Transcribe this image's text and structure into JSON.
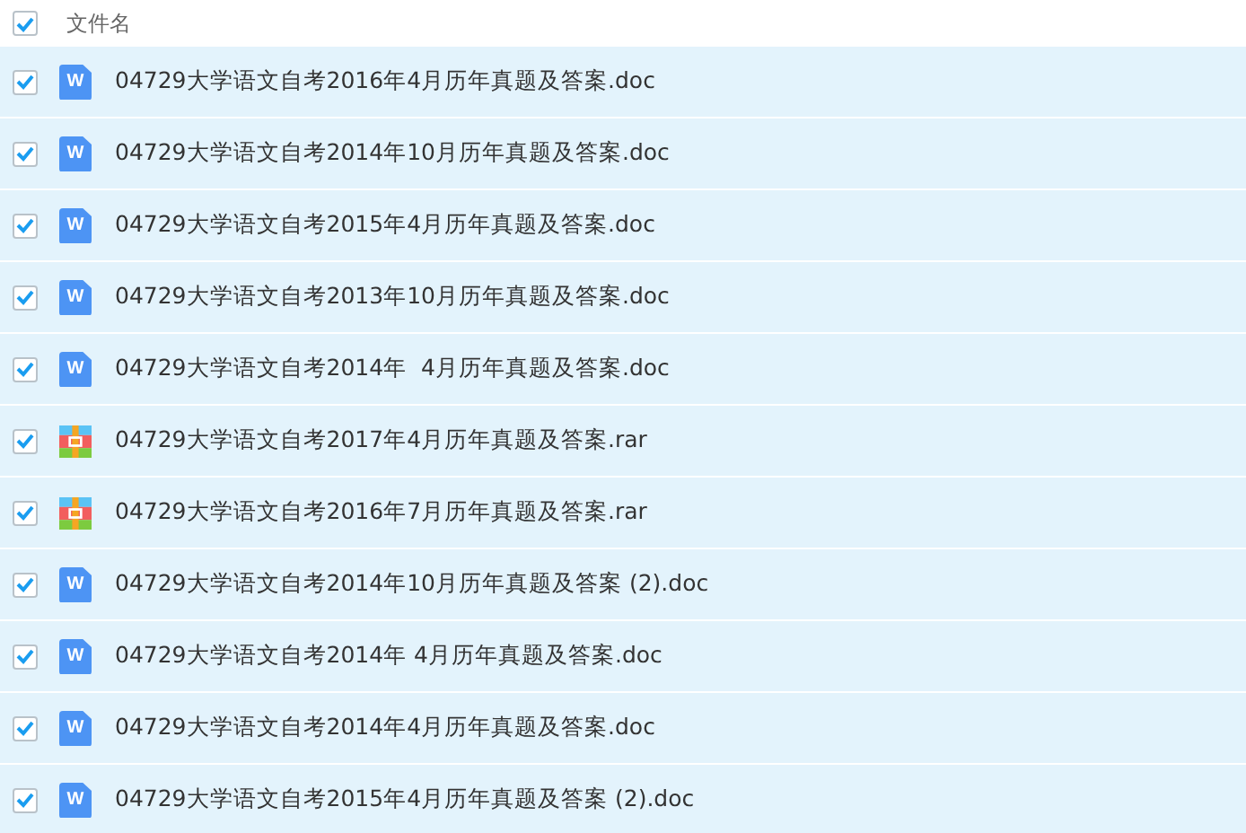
{
  "header": {
    "checked": true,
    "label": "文件名"
  },
  "rows": [
    {
      "kind": "doc",
      "icon_label": "W",
      "name": "04729大学语文自考2016年4月历年真题及答案.doc",
      "checked": true
    },
    {
      "kind": "doc",
      "icon_label": "W",
      "name": "04729大学语文自考2014年10月历年真题及答案.doc",
      "checked": true
    },
    {
      "kind": "doc",
      "icon_label": "W",
      "name": "04729大学语文自考2015年4月历年真题及答案.doc",
      "checked": true
    },
    {
      "kind": "doc",
      "icon_label": "W",
      "name": "04729大学语文自考2013年10月历年真题及答案.doc",
      "checked": true
    },
    {
      "kind": "doc",
      "icon_label": "W",
      "name": "04729大学语文自考2014年  4月历年真题及答案.doc",
      "checked": true
    },
    {
      "kind": "rar",
      "name": "04729大学语文自考2017年4月历年真题及答案.rar",
      "checked": true
    },
    {
      "kind": "rar",
      "name": "04729大学语文自考2016年7月历年真题及答案.rar",
      "checked": true
    },
    {
      "kind": "doc",
      "icon_label": "W",
      "name": "04729大学语文自考2014年10月历年真题及答案 (2).doc",
      "checked": true
    },
    {
      "kind": "doc",
      "icon_label": "W",
      "name": "04729大学语文自考2014年 4月历年真题及答案.doc",
      "checked": true
    },
    {
      "kind": "doc",
      "icon_label": "W",
      "name": "04729大学语文自考2014年4月历年真题及答案.doc",
      "checked": true
    },
    {
      "kind": "doc",
      "icon_label": "W",
      "name": "04729大学语文自考2015年4月历年真题及答案 (2).doc",
      "checked": true
    }
  ]
}
